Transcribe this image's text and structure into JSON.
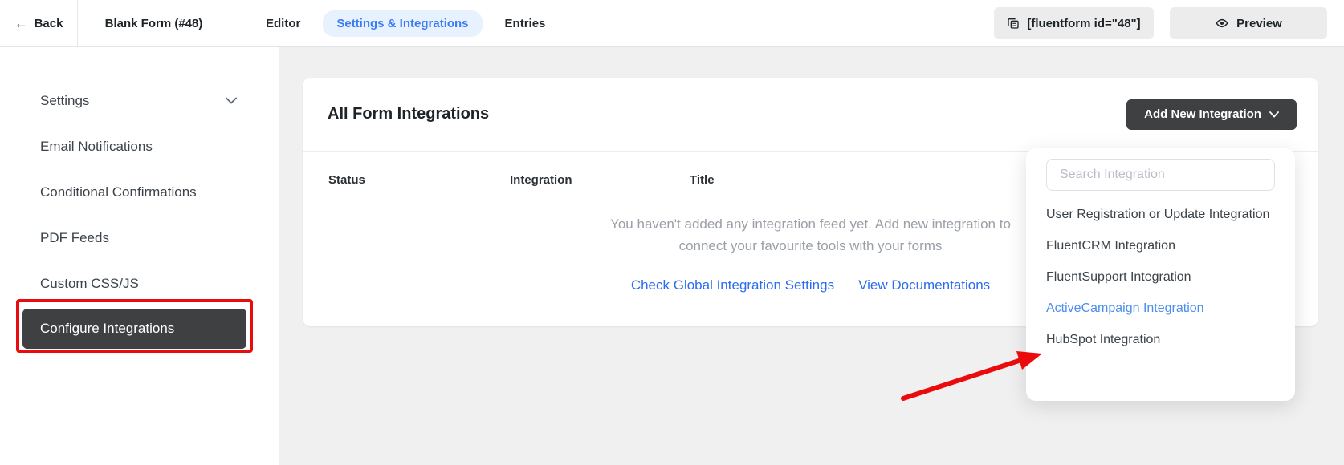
{
  "colors": {
    "accent_blue": "#3b7cf6",
    "tab_pill_bg": "#e8f1fe",
    "link_blue": "#2b6cf0",
    "highlighted_item_blue": "#4b8ef0",
    "annotation_red": "#ea0c0c",
    "dark_button_bg": "#3e4042",
    "page_bg": "#f0f0f1"
  },
  "header": {
    "back_label": "Back",
    "back_arrow": "←",
    "form_title": "Blank Form (#48)",
    "tabs": [
      {
        "label": "Editor"
      },
      {
        "label": "Settings & Integrations"
      },
      {
        "label": "Entries"
      }
    ],
    "shortcode_label": "[fluentform id=\"48\"]",
    "preview_label": "Preview"
  },
  "sidebar": {
    "items": [
      {
        "label": "Settings"
      },
      {
        "label": "Email Notifications"
      },
      {
        "label": "Conditional Confirmations"
      },
      {
        "label": "PDF Feeds"
      },
      {
        "label": "Custom CSS/JS"
      },
      {
        "label": "Configure Integrations"
      }
    ]
  },
  "main": {
    "title": "All Form Integrations",
    "add_button_label": "Add New Integration",
    "table_headers": [
      "Status",
      "Integration",
      "Title"
    ],
    "empty_line1": "You haven't added any integration feed yet. Add new integration to",
    "empty_line2": "connect your favourite tools with your forms",
    "links": [
      {
        "label": "Check Global Integration Settings"
      },
      {
        "label": "View Documentations"
      }
    ]
  },
  "dropdown": {
    "search_placeholder": "Search Integration",
    "items": [
      {
        "label": "User Registration or Update Integration"
      },
      {
        "label": "FluentCRM Integration"
      },
      {
        "label": "FluentSupport Integration"
      },
      {
        "label": "ActiveCampaign Integration"
      },
      {
        "label": "HubSpot Integration"
      }
    ]
  }
}
